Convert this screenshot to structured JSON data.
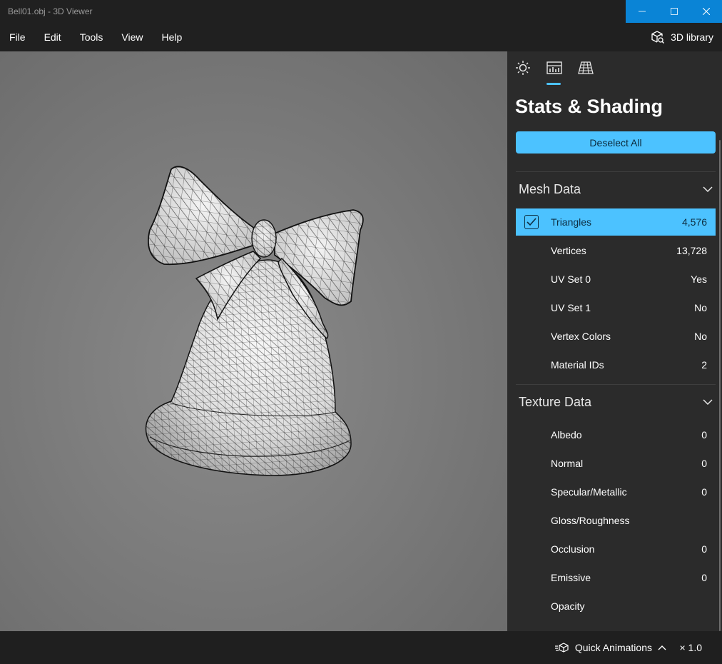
{
  "window": {
    "title": "Bell01.obj - 3D Viewer"
  },
  "menu": {
    "items": [
      "File",
      "Edit",
      "Tools",
      "View",
      "Help"
    ],
    "library_label": "3D library"
  },
  "panel": {
    "title": "Stats & Shading",
    "deselect_label": "Deselect All",
    "mesh": {
      "label": "Mesh Data",
      "rows": [
        {
          "label": "Triangles",
          "value": "4,576",
          "selected": true
        },
        {
          "label": "Vertices",
          "value": "13,728"
        },
        {
          "label": "UV Set 0",
          "value": "Yes"
        },
        {
          "label": "UV Set 1",
          "value": "No"
        },
        {
          "label": "Vertex Colors",
          "value": "No"
        },
        {
          "label": "Material IDs",
          "value": "2"
        }
      ]
    },
    "texture": {
      "label": "Texture Data",
      "rows": [
        {
          "label": "Albedo",
          "value": "0"
        },
        {
          "label": "Normal",
          "value": "0"
        },
        {
          "label": "Specular/Metallic",
          "value": "0"
        },
        {
          "label": "Gloss/Roughness",
          "value": ""
        },
        {
          "label": "Occlusion",
          "value": "0"
        },
        {
          "label": "Emissive",
          "value": "0"
        },
        {
          "label": "Opacity",
          "value": ""
        }
      ]
    }
  },
  "bottom": {
    "quick_animations_label": "Quick Animations",
    "speed_label": "× 1.0"
  },
  "colors": {
    "accent": "#4cc2ff",
    "titlebar_controls": "#0a84d6",
    "panel": "#2b2b2b"
  }
}
